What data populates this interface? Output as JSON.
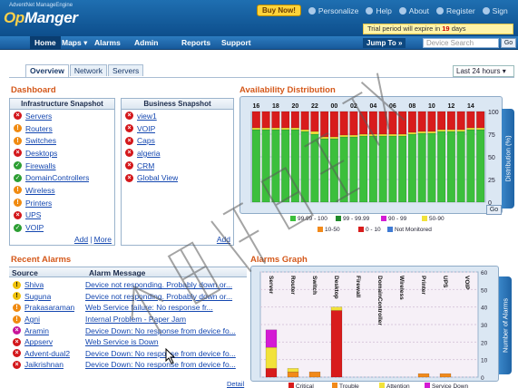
{
  "header": {
    "brand_small": "AdventNet ManageEngine",
    "brand_logo_pre": "Op",
    "brand_logo": "Manger",
    "buy_now": "Buy Now!",
    "links": [
      "Personalize",
      "Help",
      "About",
      "Register",
      "Sign"
    ],
    "trial_text": "Trial period will expire in",
    "trial_days": "19",
    "trial_suffix": "days"
  },
  "nav": {
    "items": [
      "Home",
      "Maps ▾",
      "Alarms",
      "Admin",
      "Reports",
      "Support"
    ],
    "jump_to": "Jump To »",
    "search_placeholder": "Device Search",
    "go_label": "Go"
  },
  "tabs": {
    "items": [
      "Overview",
      "Network",
      "Servers"
    ],
    "period": "Last 24 hours"
  },
  "dashboard": {
    "title": "Dashboard",
    "infra": {
      "header": "Infrastructure Snapshot",
      "items": [
        {
          "label": "Servers",
          "status": "red"
        },
        {
          "label": "Routers",
          "status": "orange"
        },
        {
          "label": "Switches",
          "status": "orange"
        },
        {
          "label": "Desktops",
          "status": "red"
        },
        {
          "label": "Firewalls",
          "status": "green"
        },
        {
          "label": "DomainControllers",
          "status": "green"
        },
        {
          "label": "Wireless",
          "status": "orange"
        },
        {
          "label": "Printers",
          "status": "orange"
        },
        {
          "label": "UPS",
          "status": "red"
        },
        {
          "label": "VOIP",
          "status": "green"
        }
      ],
      "add": "Add",
      "more": "More"
    },
    "business": {
      "header": "Business Snapshot",
      "items": [
        {
          "label": "view1",
          "status": "red"
        },
        {
          "label": "VOIP",
          "status": "red"
        },
        {
          "label": "Caps",
          "status": "red"
        },
        {
          "label": "algeria",
          "status": "red"
        },
        {
          "label": "CRM",
          "status": "red"
        },
        {
          "label": "Global View",
          "status": "red"
        }
      ],
      "add": "Add"
    }
  },
  "availability": {
    "title": "Availability Distribution",
    "side_label": "Distribution (%)",
    "go_label": "Go",
    "legend": [
      {
        "label": "99.99 - 100",
        "color": "#3cbf3c"
      },
      {
        "label": "99 - 99.99",
        "color": "#1f8a2a"
      },
      {
        "label": "90 - 99",
        "color": "#d41bd4"
      },
      {
        "label": "50-90",
        "color": "#f2e23a"
      },
      {
        "label": "10-50",
        "color": "#f28a1a"
      },
      {
        "label": "0 - 10",
        "color": "#d81c1c"
      },
      {
        "label": "Not Monitored",
        "color": "#3f7bd4"
      }
    ]
  },
  "recent_alarms": {
    "title": "Recent Alarms",
    "col_source": "Source",
    "col_message": "Alarm Message",
    "rows": [
      {
        "source": "Shiva",
        "status": "yellow",
        "message": "Device not responding. Probably down or..."
      },
      {
        "source": "Suguna",
        "status": "yellow",
        "message": "Device not responding. Probably down or..."
      },
      {
        "source": "Prakasaraman",
        "status": "orange",
        "message": "Web Service failure: No response fr..."
      },
      {
        "source": "Agni",
        "status": "orange",
        "message": "Internal Problem - Paper Jam"
      },
      {
        "source": "Aramin",
        "status": "magenta",
        "message": "Device Down: No response from device fo..."
      },
      {
        "source": "Appserv",
        "status": "red",
        "message": "Web Service is Down"
      },
      {
        "source": "Advent-dual2",
        "status": "red",
        "message": "Device Down: No response from device fo..."
      },
      {
        "source": "Jaikrishnan",
        "status": "red",
        "message": "Device Down: No response from device fo..."
      }
    ],
    "detail": "Detail"
  },
  "alarms_graph": {
    "title": "Alarms Graph",
    "side_label": "Number of Alarms",
    "legend": [
      {
        "label": "Critical",
        "color": "#d81c1c"
      },
      {
        "label": "Trouble",
        "color": "#f28a1a"
      },
      {
        "label": "Attention",
        "color": "#f2e23a"
      },
      {
        "label": "Service Down",
        "color": "#d41bd4"
      }
    ]
  },
  "chart_data": [
    {
      "type": "bar",
      "title": "Availability Distribution",
      "ylabel": "Distribution (%)",
      "ylim": [
        0,
        100
      ],
      "yticks": [
        0,
        25,
        50,
        75,
        100
      ],
      "categories": [
        "16",
        "17",
        "18",
        "19",
        "20",
        "21",
        "22",
        "23",
        "00",
        "01",
        "02",
        "03",
        "04",
        "05",
        "06",
        "07",
        "08",
        "09",
        "10",
        "11",
        "12",
        "13",
        "14",
        "15"
      ],
      "printed_category_labels": [
        "16",
        "18",
        "20",
        "22",
        "00",
        "02",
        "04",
        "06",
        "08",
        "10",
        "12",
        "14"
      ],
      "series": [
        {
          "name": "99.99 - 100",
          "values": [
            80,
            80,
            80,
            80,
            80,
            78,
            75,
            70,
            70,
            72,
            72,
            73,
            73,
            73,
            73,
            73,
            75,
            76,
            76,
            78,
            78,
            78,
            80,
            80
          ]
        },
        {
          "name": "50-90",
          "values": [
            2,
            2,
            2,
            2,
            2,
            2,
            3,
            2,
            2,
            2,
            2,
            2,
            2,
            2,
            2,
            2,
            2,
            2,
            2,
            2,
            2,
            2,
            2,
            2
          ]
        },
        {
          "name": "0 - 10",
          "values": [
            18,
            18,
            18,
            18,
            18,
            20,
            22,
            28,
            28,
            26,
            26,
            25,
            25,
            25,
            25,
            25,
            23,
            22,
            22,
            20,
            20,
            20,
            18,
            18
          ]
        }
      ]
    },
    {
      "type": "bar",
      "title": "Alarms Graph",
      "ylabel": "Number of Alarms",
      "ylim": [
        0,
        60
      ],
      "yticks": [
        0,
        10,
        20,
        30,
        40,
        50,
        60
      ],
      "categories": [
        "Server",
        "Router",
        "Switch",
        "Desktop",
        "Firewall",
        "DomainController",
        "Wireless",
        "Printer",
        "UPS",
        "VOIP"
      ],
      "series": [
        {
          "name": "Critical",
          "values": [
            5,
            0,
            0,
            38,
            0,
            0,
            0,
            0,
            0,
            0
          ]
        },
        {
          "name": "Trouble",
          "values": [
            0,
            3,
            3,
            0,
            0,
            0,
            0,
            2,
            2,
            0
          ]
        },
        {
          "name": "Attention",
          "values": [
            12,
            2,
            0,
            2,
            0,
            0,
            0,
            0,
            0,
            0
          ]
        },
        {
          "name": "Service Down",
          "values": [
            10,
            0,
            0,
            0,
            0,
            0,
            0,
            0,
            0,
            0
          ]
        }
      ]
    }
  ]
}
